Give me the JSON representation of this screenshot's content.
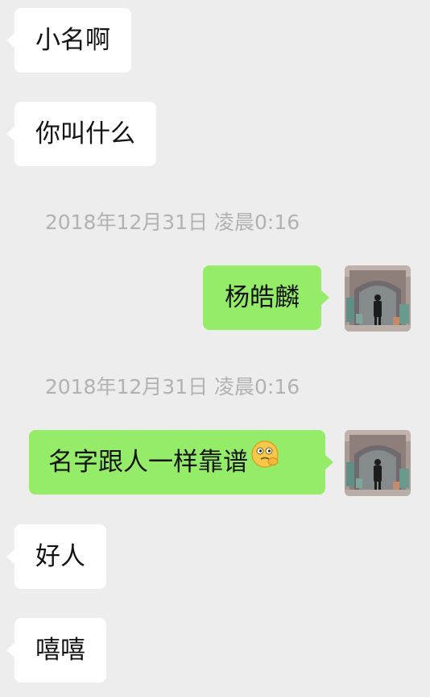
{
  "messages": [
    {
      "side": "in",
      "text": "小名啊"
    },
    {
      "side": "in",
      "text": "你叫什么"
    },
    {
      "side": "out",
      "text": "杨皓麟",
      "timestamp": "2018年12月31日 凌晨0:16"
    },
    {
      "side": "out",
      "text": "名字跟人一样靠谱",
      "timestamp": "2018年12月31日 凌晨0:16",
      "trailing_emoji": "smirk-hand-chin-emoji"
    },
    {
      "side": "in",
      "text": "好人"
    },
    {
      "side": "in",
      "text": "嘻嘻"
    }
  ],
  "colors": {
    "background": "#ededed",
    "incoming_bubble": "#ffffff",
    "outgoing_bubble": "#95ec69",
    "timestamp_text": "#b2b2b2"
  }
}
